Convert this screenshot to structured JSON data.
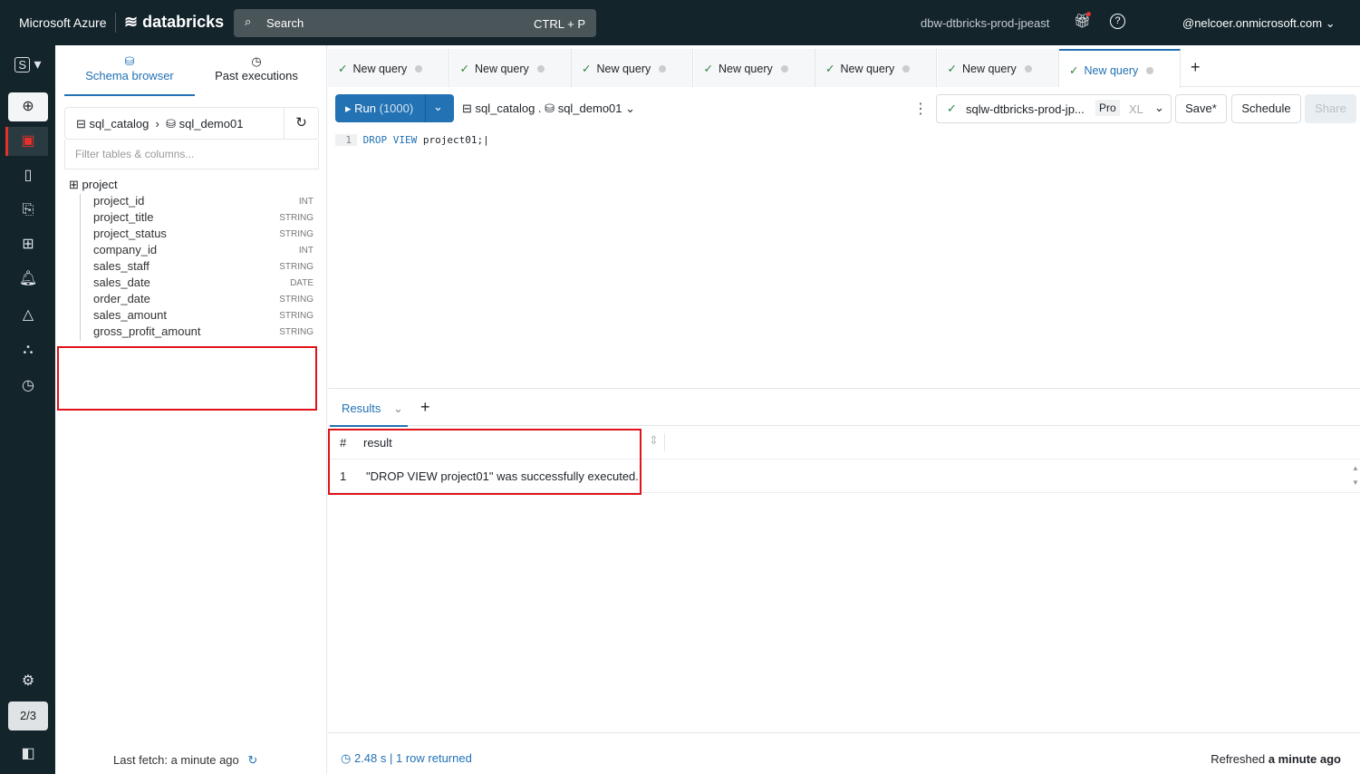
{
  "header": {
    "brand": "Microsoft Azure",
    "product": "databricks",
    "search_placeholder": "Search",
    "search_shortcut": "CTRL + P",
    "workspace": "dbw-dtbricks-prod-jpeast",
    "user": "@nelcoer.onmicrosoft.com"
  },
  "rail": {
    "workspace_badge": "S",
    "page_counter": "2/3"
  },
  "left_panel": {
    "tabs": [
      {
        "label": "Schema browser"
      },
      {
        "label": "Past executions"
      }
    ],
    "catalog": "sql_catalog",
    "schema": "sql_demo01",
    "filter_placeholder": "Filter tables & columns...",
    "table": "project",
    "columns": [
      {
        "name": "project_id",
        "type": "INT"
      },
      {
        "name": "project_title",
        "type": "STRING"
      },
      {
        "name": "project_status",
        "type": "STRING"
      },
      {
        "name": "company_id",
        "type": "INT"
      },
      {
        "name": "sales_staff",
        "type": "STRING"
      },
      {
        "name": "sales_date",
        "type": "DATE"
      },
      {
        "name": "order_date",
        "type": "STRING"
      },
      {
        "name": "sales_amount",
        "type": "STRING"
      },
      {
        "name": "gross_profit_amount",
        "type": "STRING"
      }
    ],
    "last_fetch": "Last fetch: a minute ago"
  },
  "tabs": [
    "New query",
    "New query",
    "New query",
    "New query",
    "New query",
    "New query",
    "New query"
  ],
  "toolbar": {
    "run_label": "Run",
    "run_limit": "(1000)",
    "catalog": "sql_catalog",
    "schema": "sql_demo01",
    "warehouse": "sqlw-dtbricks-prod-jp...",
    "tier": "Pro",
    "size": "XL",
    "save": "Save*",
    "schedule": "Schedule",
    "share": "Share"
  },
  "editor": {
    "line": "1",
    "keyword1": "DROP",
    "keyword2": "VIEW",
    "rest": "project01;"
  },
  "results": {
    "tab": "Results",
    "columns": [
      "#",
      "result"
    ],
    "rows": [
      {
        "n": "1",
        "result": "\"DROP VIEW project01\" was successfully executed."
      }
    ]
  },
  "status": {
    "time": "2.48 s",
    "rows": "1 row returned",
    "refreshed_prefix": "Refreshed",
    "refreshed_when": "a minute ago"
  }
}
